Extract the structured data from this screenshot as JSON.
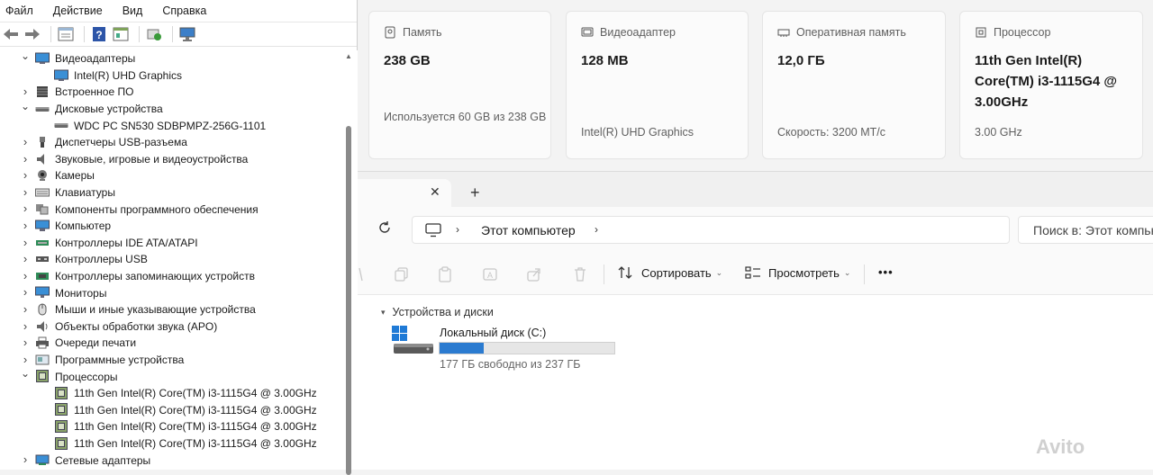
{
  "device_manager": {
    "menu": [
      "Файл",
      "Действие",
      "Вид",
      "Справка"
    ],
    "tree": [
      {
        "label": "Видеоадаптеры",
        "level": 0,
        "expanded": true,
        "icon": "display-adapter-icon"
      },
      {
        "label": "Intel(R) UHD Graphics",
        "level": 1,
        "icon": "display-adapter-icon"
      },
      {
        "label": "Встроенное ПО",
        "level": 0,
        "expanded": false,
        "icon": "firmware-icon"
      },
      {
        "label": "Дисковые устройства",
        "level": 0,
        "expanded": true,
        "icon": "disk-drive-icon"
      },
      {
        "label": "WDC PC SN530 SDBPMPZ-256G-1101",
        "level": 1,
        "icon": "disk-drive-icon"
      },
      {
        "label": "Диспетчеры USB-разъема",
        "level": 0,
        "expanded": false,
        "icon": "usb-connector-icon"
      },
      {
        "label": "Звуковые, игровые и видеоустройства",
        "level": 0,
        "expanded": false,
        "icon": "speaker-icon"
      },
      {
        "label": "Камеры",
        "level": 0,
        "expanded": false,
        "icon": "camera-icon"
      },
      {
        "label": "Клавиатуры",
        "level": 0,
        "expanded": false,
        "icon": "keyboard-icon"
      },
      {
        "label": "Компоненты программного обеспечения",
        "level": 0,
        "expanded": false,
        "icon": "software-component-icon"
      },
      {
        "label": "Компьютер",
        "level": 0,
        "expanded": false,
        "icon": "computer-icon"
      },
      {
        "label": "Контроллеры IDE ATA/ATAPI",
        "level": 0,
        "expanded": false,
        "icon": "ide-controller-icon"
      },
      {
        "label": "Контроллеры USB",
        "level": 0,
        "expanded": false,
        "icon": "usb-icon"
      },
      {
        "label": "Контроллеры запоминающих устройств",
        "level": 0,
        "expanded": false,
        "icon": "storage-controller-icon"
      },
      {
        "label": "Мониторы",
        "level": 0,
        "expanded": false,
        "icon": "monitor-icon"
      },
      {
        "label": "Мыши и иные указывающие устройства",
        "level": 0,
        "expanded": false,
        "icon": "mouse-icon"
      },
      {
        "label": "Объекты обработки звука (APO)",
        "level": 0,
        "expanded": false,
        "icon": "audio-processing-icon"
      },
      {
        "label": "Очереди печати",
        "level": 0,
        "expanded": false,
        "icon": "printer-icon"
      },
      {
        "label": "Программные устройства",
        "level": 0,
        "expanded": false,
        "icon": "software-device-icon"
      },
      {
        "label": "Процессоры",
        "level": 0,
        "expanded": true,
        "icon": "cpu-icon"
      },
      {
        "label": "11th Gen Intel(R) Core(TM) i3-1115G4 @ 3.00GHz",
        "level": 1,
        "icon": "cpu-icon"
      },
      {
        "label": "11th Gen Intel(R) Core(TM) i3-1115G4 @ 3.00GHz",
        "level": 1,
        "icon": "cpu-icon"
      },
      {
        "label": "11th Gen Intel(R) Core(TM) i3-1115G4 @ 3.00GHz",
        "level": 1,
        "icon": "cpu-icon"
      },
      {
        "label": "11th Gen Intel(R) Core(TM) i3-1115G4 @ 3.00GHz",
        "level": 1,
        "icon": "cpu-icon"
      },
      {
        "label": "Сетевые адаптеры",
        "level": 0,
        "expanded": false,
        "icon": "network-adapter-icon"
      }
    ]
  },
  "specs": {
    "storage": {
      "title": "Память",
      "value": "238 GB",
      "sub": "Используется 60 GB из 238 GB"
    },
    "gpu": {
      "title": "Видеоадаптер",
      "value": "128 MB",
      "sub": "Intel(R) UHD Graphics"
    },
    "ram": {
      "title": "Оперативная память",
      "value": "12,0 ГБ",
      "sub": "Скорость: 3200 МТ/с"
    },
    "cpu": {
      "title": "Процессор",
      "value_lines": [
        "11th Gen Intel(R)",
        "Core(TM) i3-1115G4 @",
        "3.00GHz"
      ],
      "sub": "3.00 GHz"
    }
  },
  "explorer": {
    "tab_close": "✕",
    "tab_add": "+",
    "location": "Этот компьютер",
    "search_placeholder": "Поиск в: Этот компьютер",
    "sort_label": "Сортировать",
    "view_label": "Просмотреть",
    "more_label": "•••",
    "group_title": "Устройства и диски",
    "drive": {
      "name": "Локальный диск (C:)",
      "free_text": "177 ГБ свободно из 237 ГБ",
      "used_fraction": 0.253
    }
  },
  "watermark": "Avito",
  "colors": {
    "progress": "#2b7bd0",
    "accent": "#0067c0"
  }
}
